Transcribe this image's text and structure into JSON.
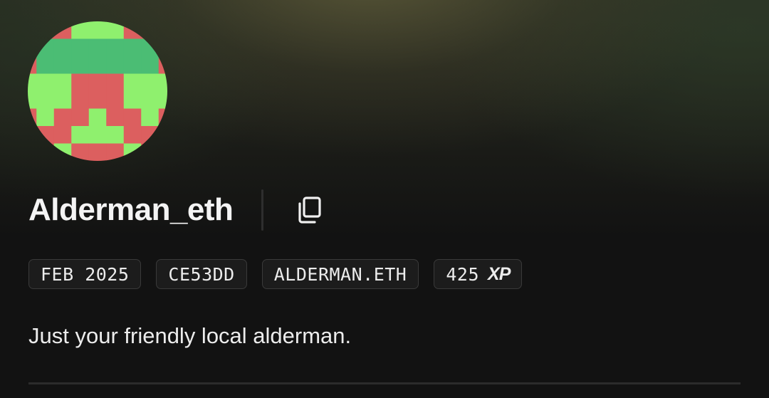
{
  "profile": {
    "username": "Alderman_eth",
    "bio": "Just your friendly local alderman.",
    "avatar_icon": "pixel-identicon-avatar",
    "copy_icon": "copy-icon"
  },
  "badges": {
    "joined": "FEB 2025",
    "code": "CE53DD",
    "ens": "ALDERMAN.ETH",
    "xp_value": "425",
    "xp_label": "XP"
  },
  "colors": {
    "background": "#121212",
    "avatar_red": "#dc5f5f",
    "avatar_light_green": "#8ff06e",
    "avatar_dark_green": "#4bbd74",
    "text": "#ececec",
    "badge_border": "#3a3a3a"
  }
}
